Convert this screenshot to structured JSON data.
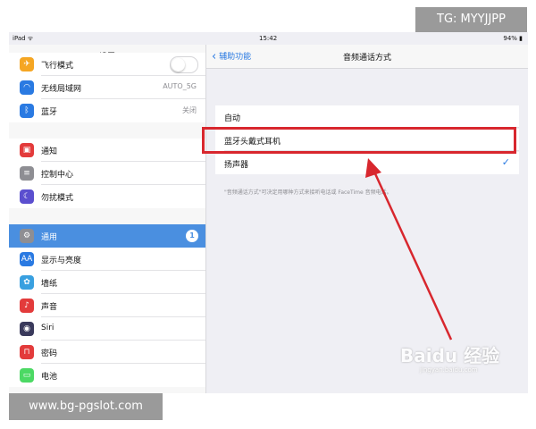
{
  "watermark": {
    "tg": "TG: MYYJJPP",
    "url": "www.bg-pgslot.com",
    "baidu": "Baidu 经验",
    "baidu_sub": "jingyan.baidu.com"
  },
  "status": {
    "device": "iPad ᯤ",
    "time": "15:42",
    "battery": "94% ▮"
  },
  "sidebar": {
    "title": "设置",
    "items": [
      {
        "label": "飞行模式",
        "icon": "airplane-icon",
        "glyph": "✈",
        "color": "#f5a623",
        "control": "toggle"
      },
      {
        "label": "无线局域网",
        "icon": "wifi-icon",
        "glyph": "◠",
        "color": "#2a7ae2",
        "value": "AUTO_5G"
      },
      {
        "label": "蓝牙",
        "icon": "bluetooth-icon",
        "glyph": "ᛒ",
        "color": "#2a7ae2",
        "value": "关闭"
      },
      {
        "label": "通知",
        "icon": "notification-icon",
        "glyph": "▣",
        "color": "#e33b3b"
      },
      {
        "label": "控制中心",
        "icon": "control-center-icon",
        "glyph": "≡",
        "color": "#8e8e93"
      },
      {
        "label": "勿扰模式",
        "icon": "moon-icon",
        "glyph": "☾",
        "color": "#5b4fcf"
      },
      {
        "label": "通用",
        "icon": "gear-icon",
        "glyph": "⚙",
        "color": "#8e8e93",
        "badge": "1",
        "selected": true
      },
      {
        "label": "显示与亮度",
        "icon": "display-icon",
        "glyph": "AA",
        "color": "#2a7ae2"
      },
      {
        "label": "墙纸",
        "icon": "wallpaper-icon",
        "glyph": "✿",
        "color": "#39a0e0"
      },
      {
        "label": "声音",
        "icon": "sound-icon",
        "glyph": "♪",
        "color": "#e33b3b"
      },
      {
        "label": "Siri",
        "icon": "siri-icon",
        "glyph": "◉",
        "color": "#3a3a5c"
      },
      {
        "label": "密码",
        "icon": "lock-icon",
        "glyph": "⊓",
        "color": "#e33b3b"
      },
      {
        "label": "电池",
        "icon": "battery-icon",
        "glyph": "▭",
        "color": "#4cd964"
      }
    ]
  },
  "detail": {
    "back_label": "辅助功能",
    "title": "音频通话方式",
    "options": [
      {
        "label": "自动"
      },
      {
        "label": "蓝牙头戴式耳机"
      },
      {
        "label": "扬声器",
        "checked": true
      }
    ],
    "footnote": "\"音频通话方式\"可决定用哪种方式来接听电话或 FaceTime 音频电话。"
  },
  "annotation": {
    "color": "#d8272e"
  }
}
